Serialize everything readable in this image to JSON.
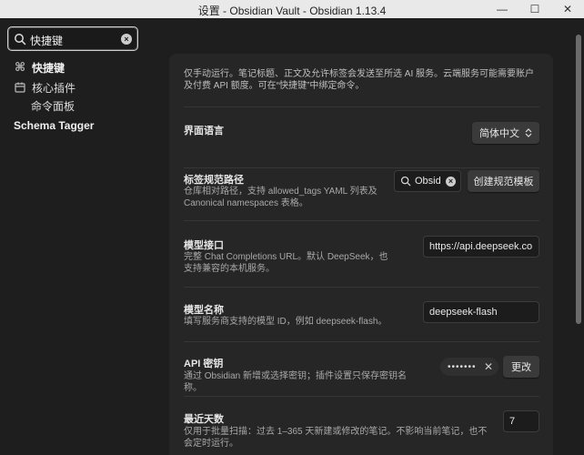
{
  "window": {
    "title": "设置 - Obsidian Vault - Obsidian 1.13.4",
    "minimize": "—",
    "maximize": "☐",
    "close": "✕"
  },
  "sidebar": {
    "search_value": "快捷键",
    "items": [
      {
        "label": "快捷键",
        "icon": "command-icon"
      },
      {
        "label": "核心插件",
        "icon": "calendar-icon"
      },
      {
        "label": "命令面板"
      },
      {
        "label": "Schema Tagger"
      }
    ]
  },
  "panel": {
    "intro": "仅手动运行。笔记标题、正文及允许标签会发送至所选 AI 服务。云端服务可能需要账户及付费 API 额度。可在“快捷键”中绑定命令。",
    "language": {
      "label": "界面语言",
      "value": "简体中文"
    },
    "tag_path": {
      "label": "标签规范路径",
      "desc": "仓库相对路径，支持 allowed_tags YAML 列表及 Canonical namespaces 表格。",
      "input_value": "Obsid",
      "button": "创建规范模板"
    },
    "model_endpoint": {
      "label": "模型接口",
      "desc": "完整 Chat Completions URL。默认 DeepSeek，也支持兼容的本机服务。",
      "value": "https://api.deepseek.co"
    },
    "model_name": {
      "label": "模型名称",
      "desc": "填写服务商支持的模型 ID，例如 deepseek-flash。",
      "value": "deepseek-flash"
    },
    "api_key": {
      "label": "API 密钥",
      "desc": "通过 Obsidian 新增或选择密钥；插件设置只保存密钥名称。",
      "masked": "•••••••",
      "button": "更改"
    },
    "recent_days": {
      "label": "最近天数",
      "desc": "仅用于批量扫描：过去 1–365 天新建或修改的笔记。不影响当前笔记，也不会定时运行。",
      "value": "7"
    }
  }
}
